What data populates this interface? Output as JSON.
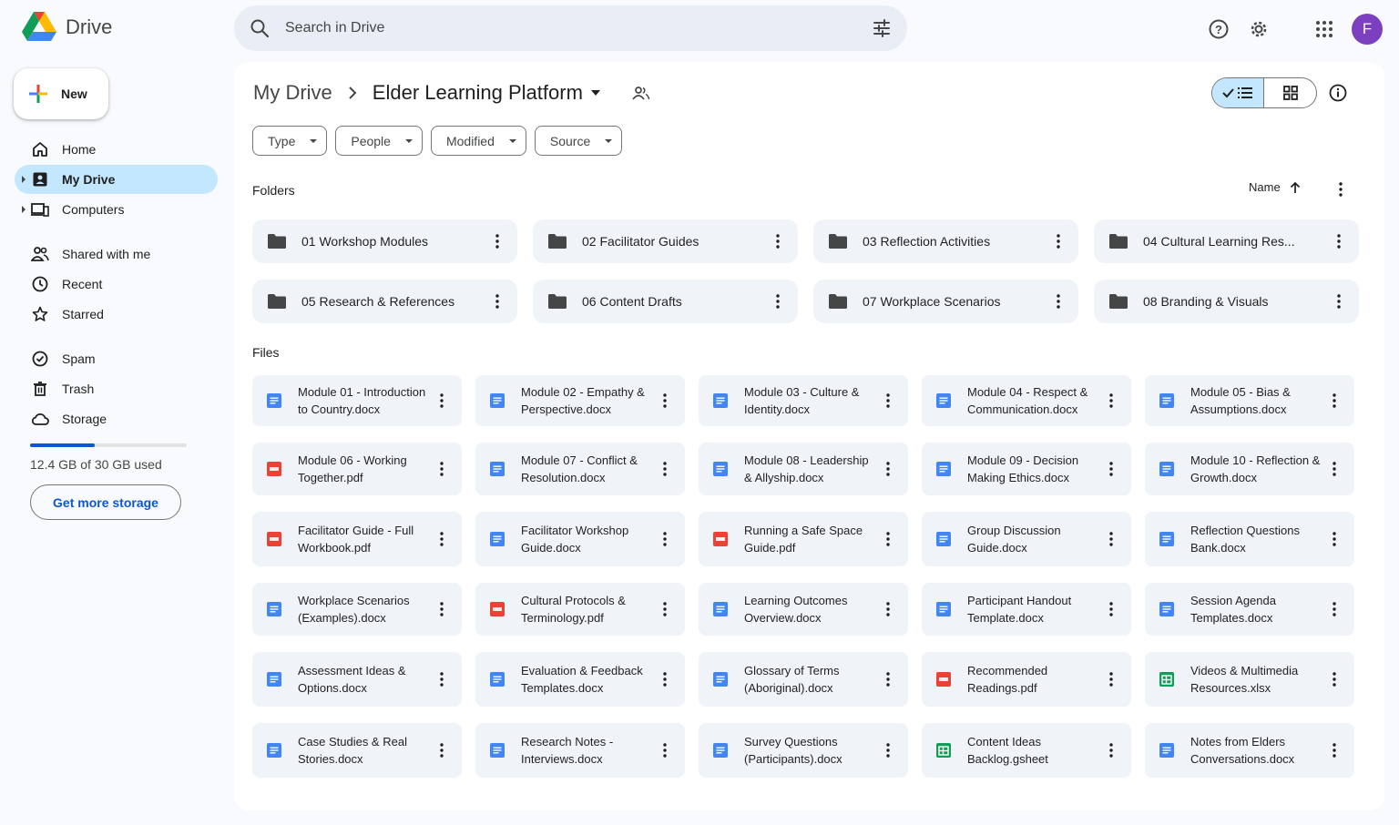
{
  "app": {
    "name": "Drive"
  },
  "search": {
    "placeholder": "Search in Drive"
  },
  "user": {
    "initial": "F",
    "avatar_color": "#7b3fbf"
  },
  "sidebar": {
    "new_label": "New",
    "items": [
      {
        "label": "Home",
        "icon": "home-icon"
      },
      {
        "label": "My Drive",
        "icon": "my-drive-icon",
        "active": true
      },
      {
        "label": "Computers",
        "icon": "computers-icon"
      },
      {
        "label": "Shared with me",
        "icon": "shared-icon"
      },
      {
        "label": "Recent",
        "icon": "clock-icon"
      },
      {
        "label": "Starred",
        "icon": "star-icon"
      },
      {
        "label": "Spam",
        "icon": "spam-icon"
      },
      {
        "label": "Trash",
        "icon": "trash-icon"
      },
      {
        "label": "Storage",
        "icon": "cloud-icon"
      }
    ],
    "storage": {
      "used_text": "12.4 GB of 30 GB used",
      "used_fraction": 0.413,
      "button_label": "Get more storage"
    }
  },
  "main": {
    "breadcrumb": {
      "root": "My Drive",
      "current": "Elder Learning Platform"
    },
    "filters": [
      "Type",
      "People",
      "Modified",
      "Source"
    ],
    "folders_label": "Folders",
    "files_label": "Files",
    "sort_label": "Name",
    "folders": [
      "01 Workshop Modules",
      "02 Facilitator Guides",
      "03 Reflection Activities",
      "04 Cultural Learning Res...",
      "05 Research & References",
      "06 Content Drafts",
      "07 Workplace Scenarios",
      "08 Branding & Visuals"
    ],
    "files": [
      {
        "name": "Module 01 - Introduction to Country.docx",
        "type": "doc"
      },
      {
        "name": "Module 02 - Empathy & Perspective.docx",
        "type": "doc"
      },
      {
        "name": "Module 03 - Culture & Identity.docx",
        "type": "doc"
      },
      {
        "name": "Module 04 - Respect & Communication.docx",
        "type": "doc"
      },
      {
        "name": "Module 05 - Bias & Assumptions.docx",
        "type": "doc"
      },
      {
        "name": "Module 06 - Working Together.pdf",
        "type": "pdf"
      },
      {
        "name": "Module 07 - Conflict & Resolution.docx",
        "type": "doc"
      },
      {
        "name": "Module 08 - Leadership & Allyship.docx",
        "type": "doc"
      },
      {
        "name": "Module 09 - Decision Making Ethics.docx",
        "type": "doc"
      },
      {
        "name": "Module 10 - Reflection & Growth.docx",
        "type": "doc"
      },
      {
        "name": "Facilitator Guide - Full Workbook.pdf",
        "type": "pdf"
      },
      {
        "name": "Facilitator Workshop Guide.docx",
        "type": "doc"
      },
      {
        "name": "Running a Safe Space Guide.pdf",
        "type": "pdf"
      },
      {
        "name": "Group Discussion Guide.docx",
        "type": "doc"
      },
      {
        "name": "Reflection Questions Bank.docx",
        "type": "doc"
      },
      {
        "name": "Workplace Scenarios (Examples).docx",
        "type": "doc"
      },
      {
        "name": "Cultural Protocols & Terminology.pdf",
        "type": "pdf"
      },
      {
        "name": "Learning Outcomes Overview.docx",
        "type": "doc"
      },
      {
        "name": "Participant Handout Template.docx",
        "type": "doc"
      },
      {
        "name": "Session Agenda Templates.docx",
        "type": "doc"
      },
      {
        "name": "Assessment Ideas & Options.docx",
        "type": "doc"
      },
      {
        "name": "Evaluation & Feedback Templates.docx",
        "type": "doc"
      },
      {
        "name": "Glossary of Terms (Aboriginal).docx",
        "type": "doc"
      },
      {
        "name": "Recommended Readings.pdf",
        "type": "pdf"
      },
      {
        "name": "Videos & Multimedia Resources.xlsx",
        "type": "sheet"
      },
      {
        "name": "Case Studies & Real Stories.docx",
        "type": "doc"
      },
      {
        "name": "Research Notes - Interviews.docx",
        "type": "doc"
      },
      {
        "name": "Survey Questions (Participants).docx",
        "type": "doc"
      },
      {
        "name": "Content Ideas Backlog.gsheet",
        "type": "sheet"
      },
      {
        "name": "Notes from Elders Conversations.docx",
        "type": "doc"
      }
    ],
    "colors": {
      "doc": "#4285f4",
      "pdf": "#ea4335",
      "sheet": "#0f9d58",
      "active_bg": "#c2e7ff",
      "accent": "#0b57d0"
    }
  }
}
